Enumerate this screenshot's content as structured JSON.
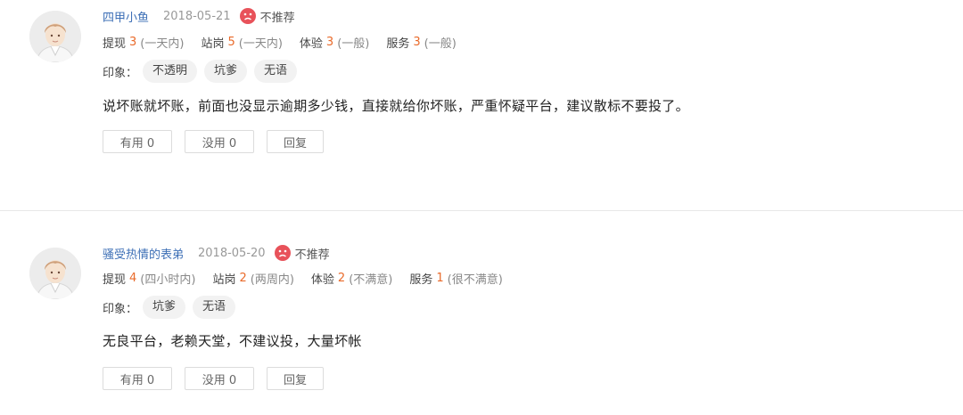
{
  "reviews": [
    {
      "username": "四甲小鱼",
      "date": "2018-05-21",
      "verdict": "不推荐",
      "ratings": [
        {
          "name": "提现",
          "score": "3",
          "desc": "(一天内)"
        },
        {
          "name": "站岗",
          "score": "5",
          "desc": "(一天内)"
        },
        {
          "name": "体验",
          "score": "3",
          "desc": "(一般)"
        },
        {
          "name": "服务",
          "score": "3",
          "desc": "(一般)"
        }
      ],
      "impression_label": "印象：",
      "tags": [
        "不透明",
        "坑爹",
        "无语"
      ],
      "content": "说坏账就坏账，前面也没显示逾期多少钱，直接就给你坏账，严重怀疑平台，建议散标不要投了。",
      "actions": {
        "useful": "有用 0",
        "useless": "没用 0",
        "reply": "回复"
      }
    },
    {
      "username": "骚受热情的表弟",
      "date": "2018-05-20",
      "verdict": "不推荐",
      "ratings": [
        {
          "name": "提现",
          "score": "4",
          "desc": "(四小时内)"
        },
        {
          "name": "站岗",
          "score": "2",
          "desc": "(两周内)"
        },
        {
          "name": "体验",
          "score": "2",
          "desc": "(不满意)"
        },
        {
          "name": "服务",
          "score": "1",
          "desc": "(很不满意)"
        }
      ],
      "impression_label": "印象：",
      "tags": [
        "坑爹",
        "无语"
      ],
      "content": "无良平台，老赖天堂，不建议投，大量坏帐",
      "actions": {
        "useful": "有用 0",
        "useless": "没用 0",
        "reply": "回复"
      }
    }
  ],
  "colors": {
    "username": "#3d6fb6",
    "score": "#e96a2a",
    "sad_icon": "#e8525a"
  },
  "icons": {
    "avatar": "avatar-icon",
    "verdict": "sad-face-icon"
  }
}
